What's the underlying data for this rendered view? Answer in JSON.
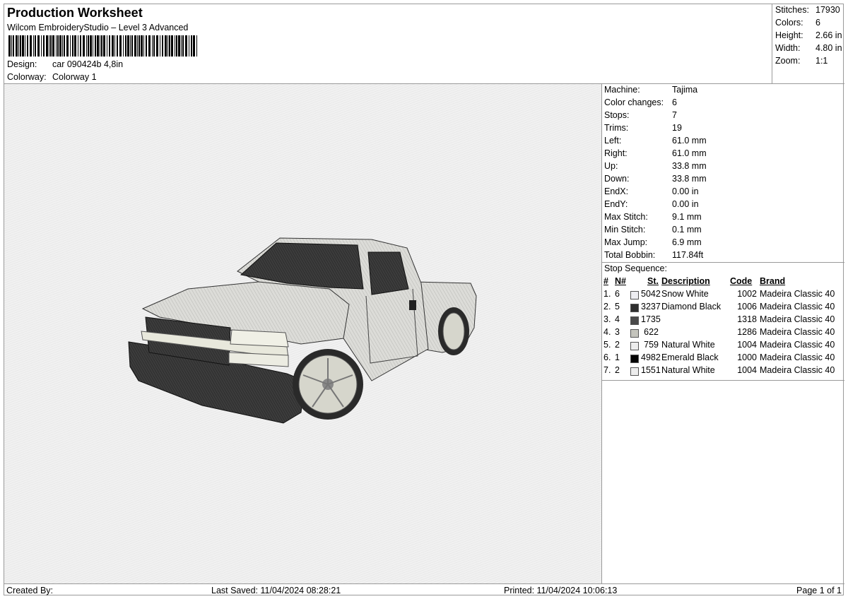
{
  "header": {
    "title": "Production Worksheet",
    "subtitle": "Wilcom EmbroideryStudio – Level 3 Advanced",
    "design_label": "Design:",
    "design_value": "car 090424b 4,8in",
    "colorway_label": "Colorway:",
    "colorway_value": "Colorway 1"
  },
  "stats": [
    {
      "label": "Stitches:",
      "value": "17930"
    },
    {
      "label": "Colors:",
      "value": "6"
    },
    {
      "label": "Height:",
      "value": "2.66 in"
    },
    {
      "label": "Width:",
      "value": "4.80 in"
    },
    {
      "label": "Zoom:",
      "value": "1:1"
    }
  ],
  "machine_info": [
    {
      "label": "Machine:",
      "value": "Tajima"
    },
    {
      "label": "Color changes:",
      "value": "6"
    },
    {
      "label": "Stops:",
      "value": "7"
    },
    {
      "label": "Trims:",
      "value": "19"
    },
    {
      "label": "Left:",
      "value": "61.0 mm"
    },
    {
      "label": "Right:",
      "value": "61.0 mm"
    },
    {
      "label": "Up:",
      "value": "33.8 mm"
    },
    {
      "label": "Down:",
      "value": "33.8 mm"
    },
    {
      "label": "EndX:",
      "value": "0.00 in"
    },
    {
      "label": "EndY:",
      "value": "0.00 in"
    },
    {
      "label": "Max Stitch:",
      "value": "9.1 mm"
    },
    {
      "label": "Min Stitch:",
      "value": "0.1 mm"
    },
    {
      "label": "Max Jump:",
      "value": "6.9 mm"
    },
    {
      "label": "Total Bobbin:",
      "value": "117.84ft"
    }
  ],
  "stop_sequence": {
    "title": "Stop Sequence:",
    "headers": [
      "#",
      "N#",
      "St.",
      "Description",
      "Code",
      "Brand"
    ],
    "rows": [
      {
        "idx": "1.",
        "n": "6",
        "color": "#eeeef2",
        "st": "5042",
        "desc": "Snow White",
        "code": "1002",
        "brand": "Madeira Classic 40"
      },
      {
        "idx": "2.",
        "n": "5",
        "color": "#2e2e2e",
        "st": "3237",
        "desc": "Diamond Black",
        "code": "1006",
        "brand": "Madeira Classic 40"
      },
      {
        "idx": "3.",
        "n": "4",
        "color": "#4a4a4a",
        "st": "1735",
        "desc": "",
        "code": "1318",
        "brand": "Madeira Classic 40"
      },
      {
        "idx": "4.",
        "n": "3",
        "color": "#c4c4bc",
        "st": "622",
        "desc": "",
        "code": "1286",
        "brand": "Madeira Classic 40"
      },
      {
        "idx": "5.",
        "n": "2",
        "color": "#ededed",
        "st": "759",
        "desc": "Natural White",
        "code": "1004",
        "brand": "Madeira Classic 40"
      },
      {
        "idx": "6.",
        "n": "1",
        "color": "#050505",
        "st": "4982",
        "desc": "Emerald Black",
        "code": "1000",
        "brand": "Madeira Classic 40"
      },
      {
        "idx": "7.",
        "n": "2",
        "color": "#ededed",
        "st": "1551",
        "desc": "Natural White",
        "code": "1004",
        "brand": "Madeira Classic 40"
      }
    ]
  },
  "footer": {
    "created_by": "Created By:",
    "last_saved": "Last Saved: 11/04/2024 08:28:21",
    "printed": "Printed: 11/04/2024 10:06:13",
    "page": "Page 1 of 1"
  }
}
